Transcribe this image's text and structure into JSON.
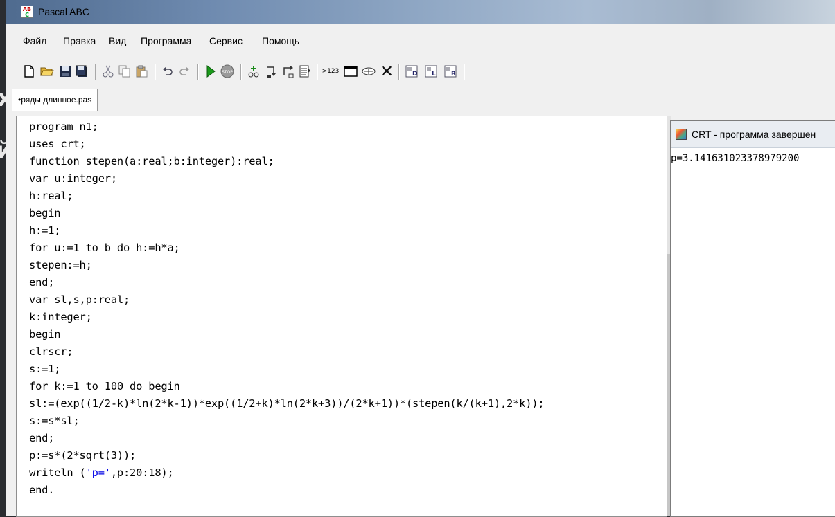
{
  "window": {
    "title": "Pascal ABC"
  },
  "menu": [
    "Файл",
    "Правка",
    "Вид",
    "Программа",
    "Сервис",
    "Помощь"
  ],
  "toolbar": {
    "buttons": [
      {
        "name": "new-file-icon",
        "glyph": "🗋"
      },
      {
        "name": "open-folder-icon",
        "glyph": "📂"
      },
      {
        "name": "save-icon",
        "glyph": "💾"
      },
      {
        "name": "save-all-icon",
        "glyph": "🗐"
      },
      {
        "name": "cut-icon",
        "glyph": "✂"
      },
      {
        "name": "copy-icon",
        "glyph": "⎘"
      },
      {
        "name": "paste-icon",
        "glyph": "📋"
      },
      {
        "name": "undo-icon",
        "glyph": "↶"
      },
      {
        "name": "redo-icon",
        "glyph": "↷"
      },
      {
        "name": "run-icon",
        "glyph": "▶"
      },
      {
        "name": "stop-icon",
        "glyph": "STOP"
      },
      {
        "name": "step-into-icon",
        "glyph": "⤵"
      },
      {
        "name": "step-over-icon",
        "glyph": "↷"
      },
      {
        "name": "step-out-icon",
        "glyph": "↱"
      },
      {
        "name": "watch-list-icon",
        "glyph": "▤"
      },
      {
        "name": "evaluate-icon",
        "glyph": ">123"
      },
      {
        "name": "output-window-icon",
        "glyph": "▭"
      },
      {
        "name": "debug-window-icon",
        "glyph": "⚲"
      },
      {
        "name": "close-icon",
        "glyph": "✕"
      },
      {
        "name": "tool-d-icon",
        "glyph": "D"
      },
      {
        "name": "tool-l-icon",
        "glyph": "L"
      },
      {
        "name": "tool-r-icon",
        "glyph": "R"
      }
    ],
    "colors": {
      "run": "#1a9a1a",
      "close": "#111111"
    }
  },
  "tab": {
    "label": "•ряды длинное.pas"
  },
  "code": [
    "program n1;",
    "uses crt;",
    "function stepen(a:real;b:integer):real;",
    "var u:integer;",
    "h:real;",
    "begin",
    "h:=1;",
    "for u:=1 to b do h:=h*a;",
    "stepen:=h;",
    "end;",
    "var sl,s,p:real;",
    "k:integer;",
    "begin",
    "clrscr;",
    "s:=1;",
    "for k:=1 to 100 do begin",
    "sl:=(exp((1/2-k)*ln(2*k-1))*exp((1/2+k)*ln(2*k+3))/(2*k+1))*(stepen(k/(k+1),2*k));",
    "s:=s*sl;",
    "end;",
    "p:=s*(2*sqrt(3));",
    "writeln ('p=',p:20:18);",
    "end."
  ],
  "crt": {
    "title": "CRT - программа завершен",
    "output": "p=3.141631023378979200"
  },
  "background_fragments": [
    "х",
    "й"
  ]
}
